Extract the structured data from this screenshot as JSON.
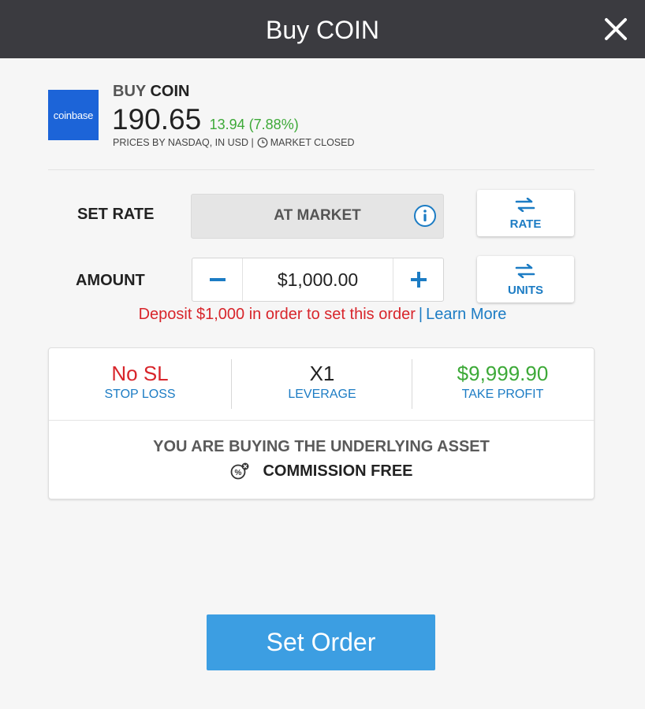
{
  "header": {
    "title": "Buy COIN"
  },
  "instrument": {
    "logo_text": "coinbase",
    "action": "BUY",
    "symbol": "COIN",
    "price": "190.65",
    "change": "13.94 (7.88%)",
    "source": "PRICES BY NASDAQ, IN USD |",
    "market_status": "MARKET CLOSED"
  },
  "rate": {
    "label": "SET RATE",
    "value": "AT MARKET",
    "toggle_label": "RATE"
  },
  "amount": {
    "label": "AMOUNT",
    "value": "$1,000.00",
    "toggle_label": "UNITS"
  },
  "deposit": {
    "message": "Deposit $1,000 in order to set this order",
    "separator": "|",
    "link": "Learn More"
  },
  "summary": {
    "stop_loss": {
      "value": "No SL",
      "label": "STOP LOSS"
    },
    "leverage": {
      "value": "X1",
      "label": "LEVERAGE"
    },
    "take_profit": {
      "value": "$9,999.90",
      "label": "TAKE PROFIT"
    },
    "underlying": "YOU ARE BUYING THE UNDERLYING ASSET",
    "commission": "COMMISSION FREE"
  },
  "cta": {
    "label": "Set Order"
  },
  "colors": {
    "header_bg": "#3b3b40",
    "accent_blue": "#1c7cc4",
    "button_blue": "#3c9ee2",
    "positive_green": "#3da938",
    "negative_red": "#d8252b",
    "coinbase_blue": "#1c64d8"
  }
}
